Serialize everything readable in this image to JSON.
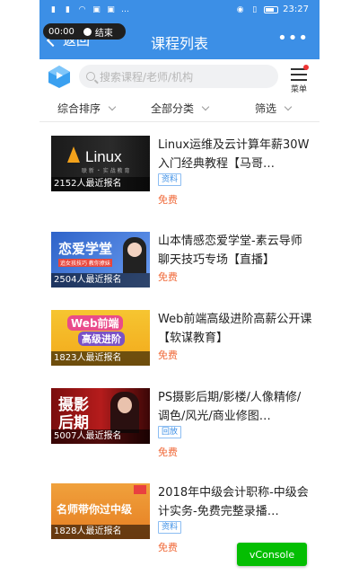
{
  "status_bar": {
    "time": "23:27",
    "battery_color": "#ffffff"
  },
  "call_pill": {
    "timer": "00:00",
    "end_label": "结束"
  },
  "header": {
    "back_label": "返回",
    "title": "课程列表",
    "more_glyph": "•••",
    "bg_color": "#3c8fe6"
  },
  "search": {
    "placeholder": "搜索课程/老师/机构",
    "menu_label": "菜单"
  },
  "filters": [
    {
      "label": "综合排序"
    },
    {
      "label": "全部分类"
    },
    {
      "label": "筛选"
    }
  ],
  "courses": [
    {
      "title": "Linux运维及云计算年薪30W入门经典教程【马哥…",
      "enrolled": "2152人最近报名",
      "tag": "资料",
      "price": "免费",
      "thumb_text": "Linux",
      "thumb_sub": "联 新 ・ 实 战 教 育"
    },
    {
      "title": "山本情感恋爱学堂-素云导师聊天技巧专场【直播】",
      "enrolled": "2504人最近报名",
      "tag": "",
      "price": "免费",
      "thumb_text": "恋爱学堂",
      "thumb_sub": "追女孩技巧  教你撩妹"
    },
    {
      "title": "Web前端高级进阶高薪公开课【软谋教育】",
      "enrolled": "1823人最近报名",
      "tag": "",
      "price": "免费",
      "thumb_text": "Web前端",
      "thumb_sub": "高级进阶"
    },
    {
      "title": "PS摄影后期/影楼/人像精修/调色/风光/商业修图…",
      "enrolled": "5007人最近报名",
      "tag": "回放",
      "price": "免费",
      "thumb_text": "摄影",
      "thumb_sub": "后期"
    },
    {
      "title": "2018年中级会计职称-中级会计实务-免费完整录播…",
      "enrolled": "1828人最近报名",
      "tag": "资料",
      "price": "免费",
      "thumb_text": "名师带你过中级",
      "thumb_sub": ""
    }
  ],
  "vconsole": {
    "label": "vConsole",
    "color": "#04be02"
  },
  "price_color": "#f06a3a",
  "accent": "#3c8fe6"
}
